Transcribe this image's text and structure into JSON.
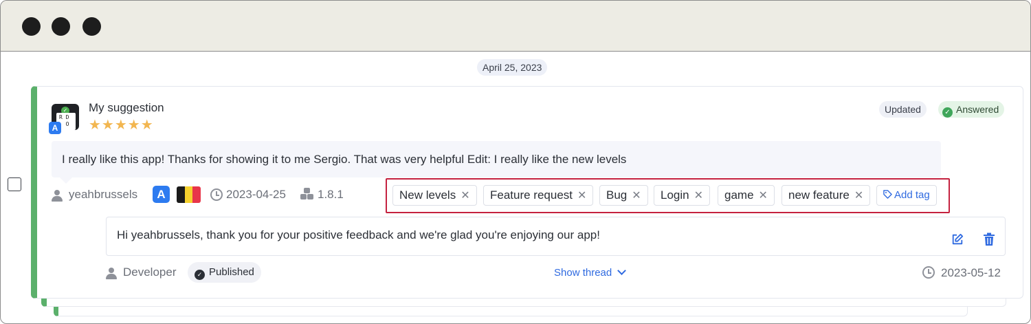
{
  "date_separator": "April 25, 2023",
  "review": {
    "title": "My suggestion",
    "rating": 5,
    "stars": "★★★★★",
    "status_updated": "Updated",
    "status_answered": "Answered",
    "body": "I really like this app! Thanks for showing it to me Sergio. That was very helpful Edit: I really like the new levels",
    "author": "yeahbrussels",
    "date": "2023-04-25",
    "app_version": "1.8.1",
    "store_icon": "app-store-icon",
    "country_flag": "belgium-flag",
    "app_icon_text": "R D\n  O"
  },
  "tags": [
    {
      "label": "New levels"
    },
    {
      "label": "Feature request"
    },
    {
      "label": "Bug"
    },
    {
      "label": "Login"
    },
    {
      "label": "game"
    },
    {
      "label": "new feature"
    }
  ],
  "add_tag_label": "Add tag",
  "reply": {
    "text": "Hi yeahbrussels, thank you for your positive feedback and we're glad you're enjoying our app!",
    "author": "Developer",
    "status": "Published",
    "show_thread": "Show thread",
    "date": "2023-05-12"
  },
  "colors": {
    "accent_green": "#5bb06b",
    "highlight_red": "#c4213f",
    "link_blue": "#2f6ae0",
    "star_orange": "#f2b650"
  }
}
